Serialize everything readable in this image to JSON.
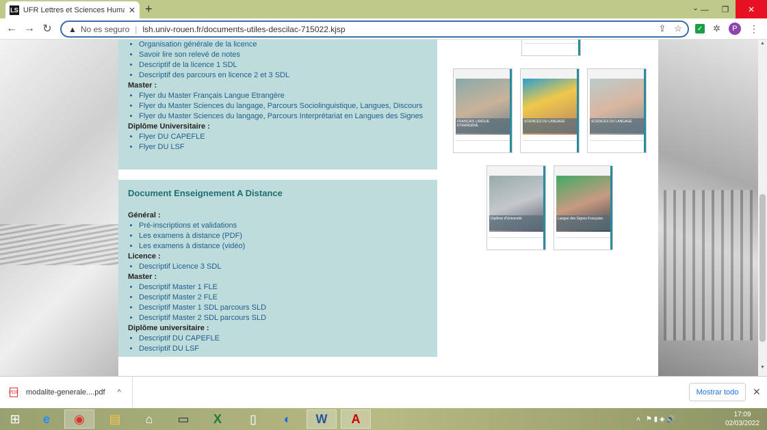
{
  "browser": {
    "tab_title": "UFR Lettres et Sciences Humaines",
    "tab_favicon": "LS",
    "new_tab": "+",
    "window": {
      "min": "—",
      "restore": "❐",
      "close": "✕"
    },
    "tab_search": "⌄",
    "nav": {
      "back": "←",
      "forward": "→",
      "reload": "↻"
    },
    "omnibox": {
      "warn_icon": "▲",
      "insecure_label": "No es seguro",
      "sep": "|",
      "url": "lsh.univ-rouen.fr/documents-utiles-descilac-715022.kjsp",
      "share_icon": "⇪",
      "bookmark_icon": "☆"
    },
    "extensions": {
      "check": "✓",
      "puzzle": "✲",
      "profile": "P",
      "menu": "⋮"
    }
  },
  "page": {
    "panel1": {
      "licence_items": [
        "Organisation générale de la licence",
        "Savoir lire son relevé de notes",
        "Descriptif de la licence 1 SDL",
        "Descriptif des parcours en licence 2 et 3 SDL"
      ],
      "master_heading": "Master :",
      "master_items": [
        "Flyer du Master Français Langue Etrangère",
        "Flyer du Master Sciences du langage, Parcours Sociolinguistique, Langues, Discours",
        "Flyer du Master Sciences du langage, Parcours Interprétariat en Langues des Signes"
      ],
      "du_heading": "Diplôme Universitaire :",
      "du_items": [
        "Flyer DU CAPEFLE",
        "Flyer DU LSF"
      ]
    },
    "panel2": {
      "title": "Document Enseignement A Distance",
      "general_heading": "Général :",
      "general_items": [
        "Pré-inscriptions et validations",
        "Les examens à distance (PDF)",
        "Les examens à distance (vidéo)"
      ],
      "licence_heading": "Licence :",
      "licence_items": [
        "Descriptif Licence 3 SDL"
      ],
      "master_heading": "Master :",
      "master_items": [
        "Descriptif Master 1 FLE",
        "Descriptif Master 2 FLE",
        "Descriptif Master 1 SDL parcours SLD",
        "Descriptif Master 2 SDL parcours SLD"
      ],
      "du_heading": "Diplôme universitaire :",
      "du_items": [
        "Descriptif DU CAPEFLE",
        "Descriptif DU LSF"
      ]
    },
    "brochures": [
      {
        "label": "FRANÇAIS LANGUE ÉTRANGÈRE"
      },
      {
        "label": "SCIENCES DU LANGAGE"
      },
      {
        "label": "SCIENCES DU LANGAGE"
      },
      {
        "label": "Diplôme d'Université"
      },
      {
        "label": "Langue des Signes Française"
      }
    ]
  },
  "scrollbar": {
    "up": "▲",
    "down": "▼"
  },
  "downloads": {
    "file_icon": "PDF",
    "file_name": "modalite-generale....pdf",
    "chevron": "^",
    "show_all": "Mostrar todo",
    "close": "✕"
  },
  "taskbar": {
    "apps": [
      {
        "name": "windows-start",
        "glyph": "⊞"
      },
      {
        "name": "internet-explorer",
        "glyph": "e"
      },
      {
        "name": "chrome",
        "glyph": "◉"
      },
      {
        "name": "file-explorer",
        "glyph": "▤"
      },
      {
        "name": "home",
        "glyph": "⌂"
      },
      {
        "name": "monitor",
        "glyph": "▭"
      },
      {
        "name": "excel",
        "glyph": "X"
      },
      {
        "name": "document",
        "glyph": "▯"
      },
      {
        "name": "edge",
        "glyph": "◐"
      },
      {
        "name": "word",
        "glyph": "W"
      },
      {
        "name": "acrobat",
        "glyph": "A"
      }
    ],
    "tray": {
      "up": "˄",
      "icons": "⚑ ▮ ◈ 🔊"
    },
    "time": "17:09",
    "date": "02/03/2022"
  }
}
